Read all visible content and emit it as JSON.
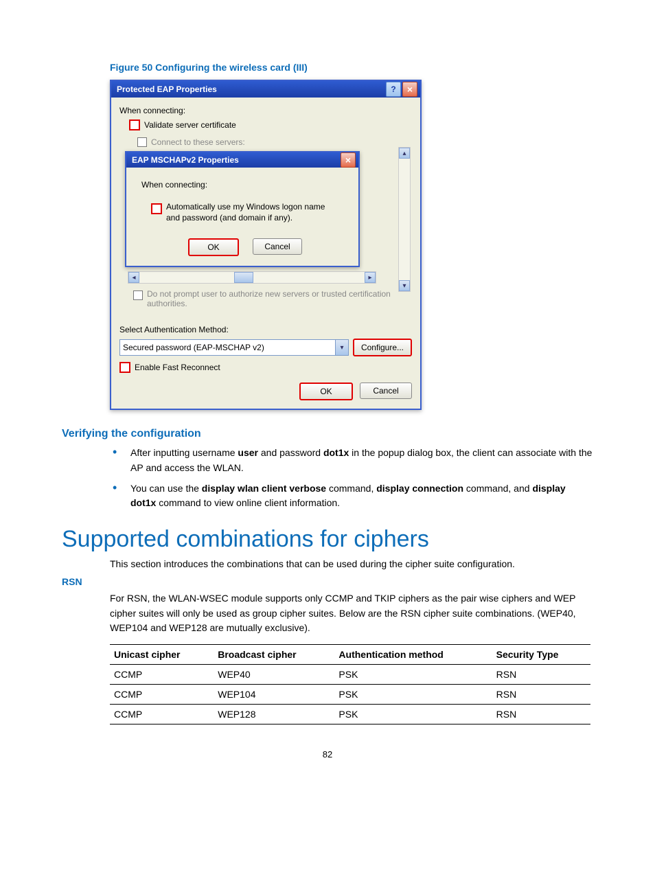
{
  "figure_caption": "Figure 50 Configuring the wireless card (III)",
  "outer": {
    "title": "Protected EAP Properties",
    "when_connecting": "When connecting:",
    "validate": "Validate server certificate",
    "connect_servers": "Connect to these servers:",
    "no_prompt": "Do not prompt user to authorize new servers or trusted certification authorities.",
    "select_auth": "Select Authentication Method:",
    "auth_value": "Secured password (EAP-MSCHAP v2)",
    "configure": "Configure...",
    "fast_reconnect": "Enable Fast Reconnect",
    "ok": "OK",
    "cancel": "Cancel"
  },
  "inner": {
    "title": "EAP MSCHAPv2 Properties",
    "when_connecting": "When connecting:",
    "auto_logon": "Automatically use my Windows logon name and password (and domain if any).",
    "ok": "OK",
    "cancel": "Cancel"
  },
  "verify_heading": "Verifying the configuration",
  "bullets": [
    {
      "pre": "After inputting username ",
      "b1": "user",
      "mid": " and password ",
      "b2": "dot1x",
      "post": " in the popup dialog box, the client can associate with the AP and access the WLAN."
    },
    {
      "pre": "You can use the ",
      "b1": "display wlan client verbose",
      "mid": " command, ",
      "b2": "display connection",
      "mid2": " command, and ",
      "b3": "display dot1x",
      "post": " command to view online client information."
    }
  ],
  "big_heading": "Supported combinations for ciphers",
  "intro": "This section introduces the combinations that can be used during the cipher suite configuration.",
  "rsn_heading": "RSN",
  "rsn_text": "For RSN, the WLAN-WSEC module supports only CCMP and TKIP ciphers as the pair wise ciphers and WEP cipher suites will only be used as group cipher suites. Below are the RSN cipher suite combinations. (WEP40, WEP104 and WEP128 are mutually exclusive).",
  "table": {
    "headers": [
      "Unicast cipher",
      "Broadcast cipher",
      "Authentication method",
      "Security Type"
    ],
    "rows": [
      [
        "CCMP",
        "WEP40",
        "PSK",
        "RSN"
      ],
      [
        "CCMP",
        "WEP104",
        "PSK",
        "RSN"
      ],
      [
        "CCMP",
        "WEP128",
        "PSK",
        "RSN"
      ]
    ]
  },
  "page_number": "82"
}
